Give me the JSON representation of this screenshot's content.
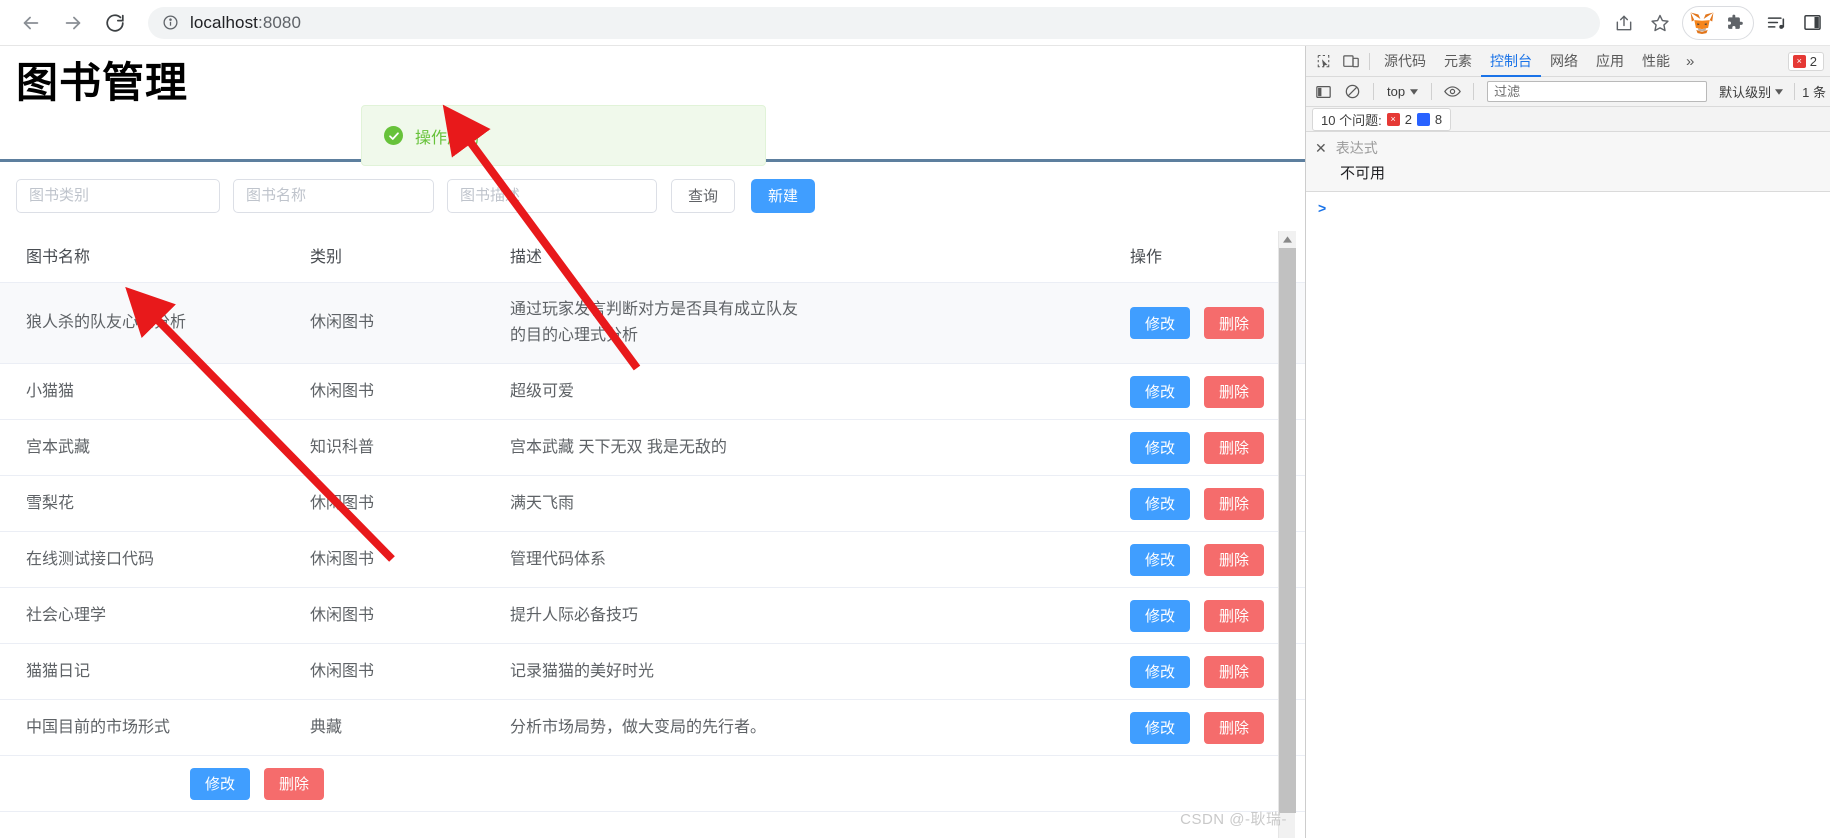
{
  "browser": {
    "url_host": "localhost",
    "url_port": ":8080",
    "icons": {
      "back": "back-arrow-icon",
      "forward": "forward-arrow-icon",
      "reload": "reload-icon",
      "site_info": "site-info-icon",
      "share": "share-icon",
      "bookmark": "bookmark-star-icon",
      "metamask": "metamask-fox-icon",
      "extensions": "puzzle-extensions-icon",
      "media": "media-list-icon",
      "sidepanel": "side-panel-icon"
    }
  },
  "app": {
    "title": "图书管理",
    "toast": {
      "message": "操作成功",
      "icon": "success-check-icon",
      "color": "#67c23a",
      "bg": "#f0f9eb"
    },
    "search": {
      "category_placeholder": "图书类别",
      "category_value": "",
      "name_placeholder": "图书名称",
      "name_value": "",
      "desc_placeholder": "图书描述",
      "desc_value": "",
      "query_label": "查询",
      "create_label": "新建"
    },
    "table": {
      "headers": [
        "图书名称",
        "类别",
        "描述",
        "操作"
      ],
      "row_actions": {
        "edit": "修改",
        "delete": "删除"
      },
      "rows": [
        {
          "name": "狼人杀的队友心态分析",
          "category": "休闲图书",
          "desc_line1": "通过玩家发言判断对方是否具有成立队友",
          "desc_line2": "的目的心理式分析"
        },
        {
          "name": "小猫猫",
          "category": "休闲图书",
          "desc_line1": "超级可爱",
          "desc_line2": ""
        },
        {
          "name": "宫本武藏",
          "category": "知识科普",
          "desc_line1": "宫本武藏 天下无双 我是无敌的",
          "desc_line2": ""
        },
        {
          "name": "雪梨花",
          "category": "休闲图书",
          "desc_line1": "满天飞雨",
          "desc_line2": ""
        },
        {
          "name": "在线测试接口代码",
          "category": "休闲图书",
          "desc_line1": "管理代码体系",
          "desc_line2": ""
        },
        {
          "name": "社会心理学",
          "category": "休闲图书",
          "desc_line1": "提升人际必备技巧",
          "desc_line2": ""
        },
        {
          "name": "猫猫日记",
          "category": "休闲图书",
          "desc_line1": "记录猫猫的美好时光",
          "desc_line2": ""
        },
        {
          "name": "中国目前的市场形式",
          "category": "典藏",
          "desc_line1": "分析市场局势，做大变局的先行者。",
          "desc_line2": ""
        }
      ]
    },
    "colors": {
      "primary": "#409eff",
      "danger": "#f56c6c",
      "divider": "#5d7f9e"
    },
    "watermark": "CSDN @-耿瑞-"
  },
  "devtools": {
    "tabs": [
      {
        "label": "源代码",
        "active": false
      },
      {
        "label": "元素",
        "active": false
      },
      {
        "label": "控制台",
        "active": true
      },
      {
        "label": "网络",
        "active": false
      },
      {
        "label": "应用",
        "active": false
      },
      {
        "label": "性能",
        "active": false
      }
    ],
    "more_label": "»",
    "error_badge_count": "2",
    "toolbar": {
      "context": "top",
      "filter_placeholder": "过滤",
      "filter_value": "",
      "level_label": "默认级别",
      "hidden_label": "1 条"
    },
    "issues": {
      "label": "10 个问题:",
      "errors": "2",
      "infos": "8"
    },
    "watch": {
      "close": "✕",
      "label": "表达式",
      "value": "不可用"
    },
    "prompt": ">"
  }
}
